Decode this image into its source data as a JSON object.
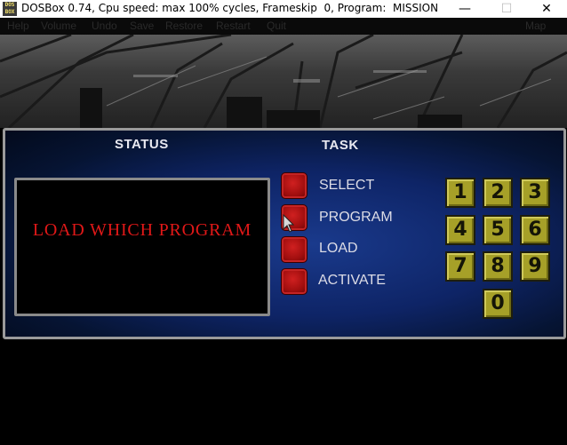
{
  "window": {
    "title": "DOSBox 0.74, Cpu speed: max 100% cycles, Frameskip  0, Program:  MISSION",
    "icon_text": "DOS BOX",
    "minimize": "—",
    "maximize": "☐",
    "close": "✕"
  },
  "menubar": {
    "items": [
      "Help",
      "Volume",
      "Undo",
      "Save",
      "Restore",
      "Restart",
      "Quit"
    ],
    "right_item": "Map"
  },
  "panel": {
    "status_header": "STATUS",
    "task_header": "TASK",
    "status_message": "LOAD WHICH PROGRAM",
    "tasks": [
      "SELECT",
      "PROGRAM",
      "LOAD",
      "ACTIVATE"
    ],
    "keypad": [
      "1",
      "2",
      "3",
      "4",
      "5",
      "6",
      "7",
      "8",
      "9",
      "0"
    ]
  },
  "colors": {
    "status_text": "#e01818",
    "task_button": "#b01212",
    "keypad_key": "#a6a028",
    "panel_bg": "#0e2466"
  }
}
